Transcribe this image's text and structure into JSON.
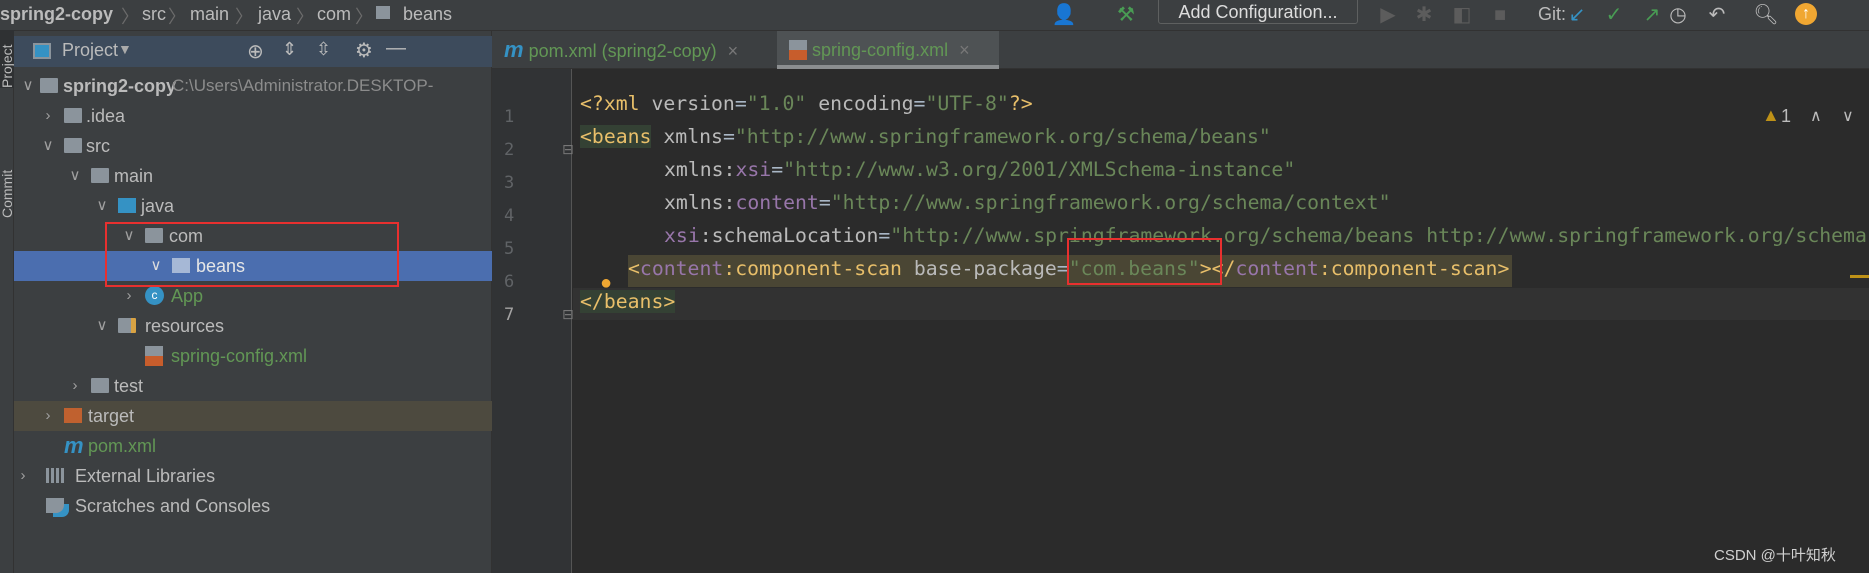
{
  "breadcrumb": [
    "spring2-copy",
    "src",
    "main",
    "java",
    "com",
    "beans"
  ],
  "toolbar": {
    "add_configuration": "Add Configuration...",
    "git_label": "Git:"
  },
  "left_stripe": {
    "project": "Project",
    "commit": "Commit"
  },
  "project_panel": {
    "title": "Project",
    "tree": [
      {
        "label": "spring2-copy",
        "path": "C:\\Users\\Administrator.DESKTOP-",
        "icon": "module-folder",
        "expanded": true
      },
      {
        "label": ".idea",
        "icon": "folder",
        "expanded": false
      },
      {
        "label": "src",
        "icon": "folder",
        "expanded": true
      },
      {
        "label": "main",
        "icon": "folder",
        "expanded": true
      },
      {
        "label": "java",
        "icon": "source-folder",
        "expanded": true
      },
      {
        "label": "com",
        "icon": "package",
        "expanded": true
      },
      {
        "label": "beans",
        "icon": "package",
        "expanded": true,
        "selected": true
      },
      {
        "label": "App",
        "icon": "class",
        "expanded": false
      },
      {
        "label": "resources",
        "icon": "resources-folder",
        "expanded": true
      },
      {
        "label": "spring-config.xml",
        "icon": "xml-file"
      },
      {
        "label": "test",
        "icon": "folder",
        "expanded": false
      },
      {
        "label": "target",
        "icon": "excluded-folder",
        "expanded": false
      },
      {
        "label": "pom.xml",
        "icon": "maven"
      },
      {
        "label": "External Libraries",
        "icon": "libraries",
        "expanded": false
      },
      {
        "label": "Scratches and Consoles",
        "icon": "scratches"
      }
    ]
  },
  "editor": {
    "tabs": [
      {
        "label": "pom.xml (spring2-copy)",
        "active": false
      },
      {
        "label": "spring-config.xml",
        "active": true
      }
    ],
    "warnings": "1",
    "line_numbers": [
      "1",
      "2",
      "3",
      "4",
      "5",
      "6",
      "7"
    ]
  },
  "code": {
    "l1": [
      "<?xml ",
      "version",
      "=",
      "\"1.0\"",
      " ",
      "encoding",
      "=",
      "\"UTF-8\"",
      "?>"
    ],
    "l2": [
      "<beans",
      " xmlns",
      "=",
      "\"http://www.springframework.org/schema/beans\""
    ],
    "l3": [
      "xmlns:",
      "xsi",
      "=",
      "\"http://www.w3.org/2001/XMLSchema-instance\""
    ],
    "l4": [
      "xmlns:",
      "content",
      "=",
      "\"http://www.springframework.org/schema/context\""
    ],
    "l5": [
      "xsi",
      ":schemaLocation",
      "=",
      "\"http://www.springframework.org/schema/beans http://www.springframework.org/schema"
    ],
    "l6": [
      "<",
      "content",
      ":component-scan ",
      "base-package",
      "=",
      "\"com.beans\"",
      "></",
      "content",
      ":component-scan>"
    ],
    "l7": "</beans>"
  },
  "watermark": "CSDN @十叶知秋",
  "colors": {
    "selection": "#4b6eaf",
    "highlight_box": "#e8302f",
    "tag": "#e8bf6a",
    "string": "#6a8759",
    "namespace": "#9876aa"
  }
}
